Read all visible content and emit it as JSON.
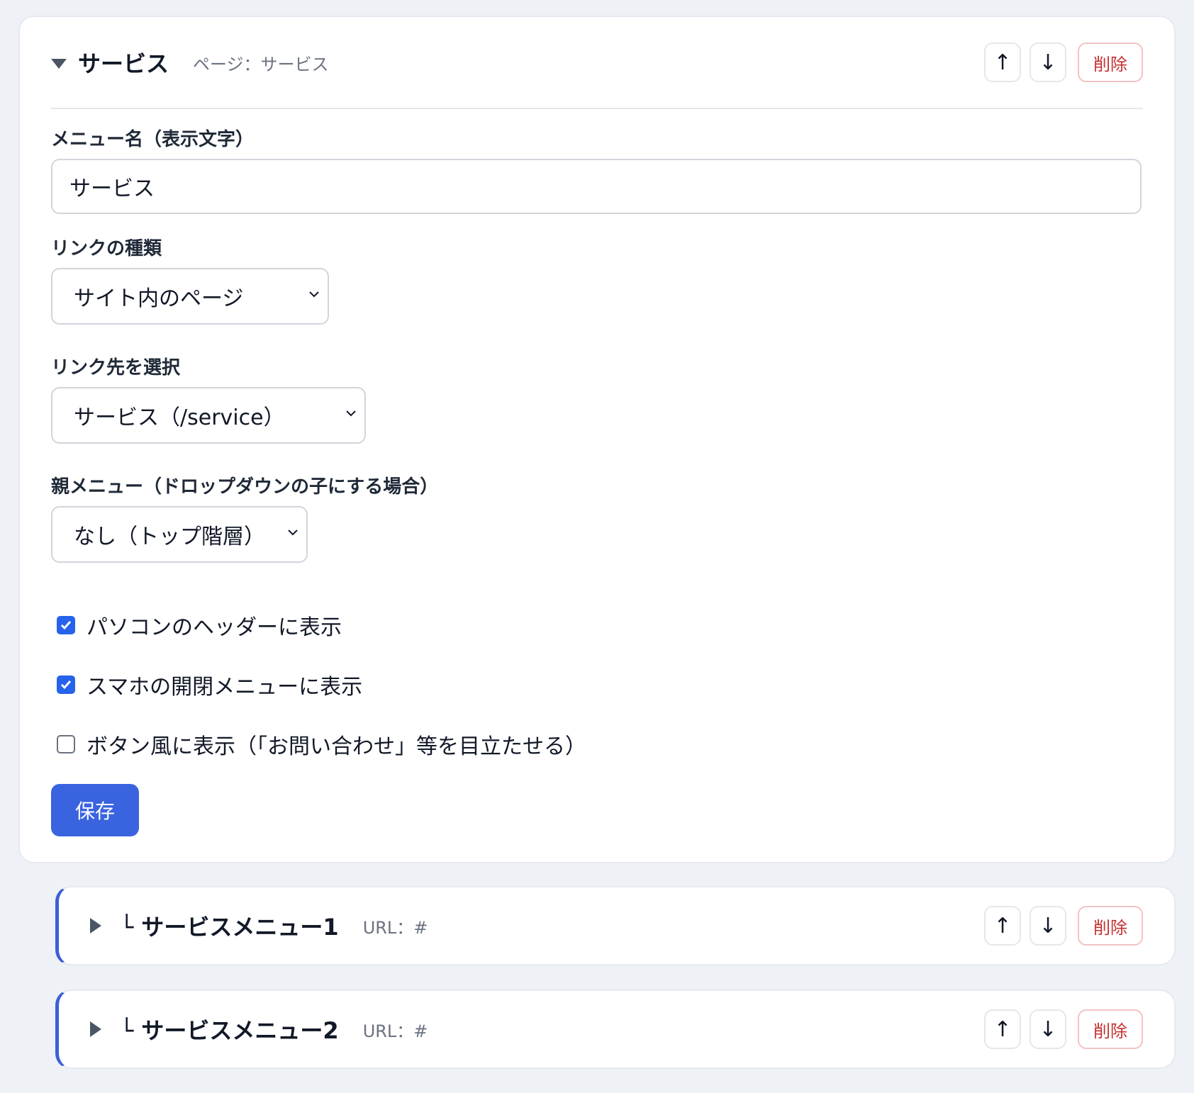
{
  "main_item": {
    "title": "サービス",
    "meta": "ページ：サービス",
    "up_label": "↑",
    "down_label": "↓",
    "delete_label": "削除"
  },
  "form": {
    "menu_name_label": "メニュー名（表示文字）",
    "menu_name_value": "サービス",
    "link_type_label": "リンクの種類",
    "link_type_value": "サイト内のページ",
    "link_target_label": "リンク先を選択",
    "link_target_value": "サービス（/service）",
    "parent_label": "親メニュー（ドロップダウンの子にする場合）",
    "parent_value": "なし（トップ階層）",
    "checkboxes": [
      {
        "label": "パソコンのヘッダーに表示",
        "checked": true
      },
      {
        "label": "スマホの開閉メニューに表示",
        "checked": true
      },
      {
        "label": "ボタン風に表示（「お問い合わせ」等を目立たせる）",
        "checked": false
      }
    ],
    "save_label": "保存"
  },
  "sub_items": [
    {
      "title": "└ サービスメニュー1",
      "meta": "URL：#",
      "up_label": "↑",
      "down_label": "↓",
      "delete_label": "削除"
    },
    {
      "title": "└ サービスメニュー2",
      "meta": "URL：#",
      "up_label": "↑",
      "down_label": "↓",
      "delete_label": "削除"
    }
  ],
  "colors": {
    "accent": "#3a63e0",
    "delete": "#c53030",
    "sub_border": "#3b5fd6",
    "background": "#eef2f7"
  }
}
